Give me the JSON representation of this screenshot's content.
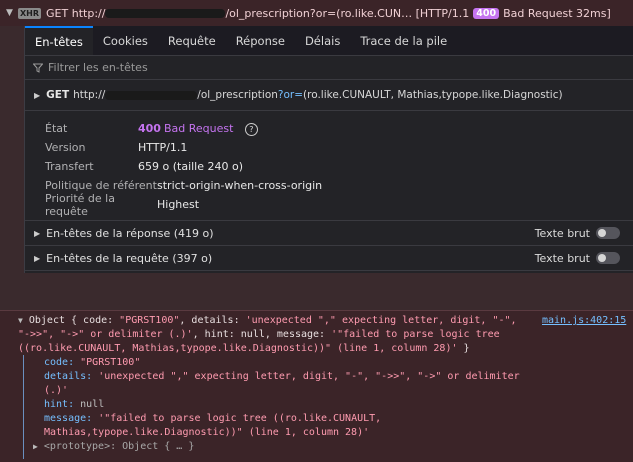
{
  "request": {
    "badge": "XHR",
    "method": "GET",
    "url_prefix": "http://",
    "url_suffix": "/ol_prescription?or=(ro.like.CUN…",
    "protocol": "[HTTP/1.1",
    "status_code": "400",
    "status_text": "Bad Request 32ms]"
  },
  "tabs": [
    "En-têtes",
    "Cookies",
    "Requête",
    "Réponse",
    "Délais",
    "Trace de la pile"
  ],
  "filter_placeholder": "Filtrer les en-têtes",
  "url_row": {
    "method": "GET",
    "url_prefix": "http://",
    "path": "/ol_prescription",
    "query": "?or=",
    "query_value": "(ro.like.CUNAULT, Mathias,typope.like.Diagnostic)"
  },
  "props": {
    "etat_label": "État",
    "etat_code": "400",
    "etat_text": "Bad Request",
    "version_label": "Version",
    "version_value": "HTTP/1.1",
    "transfert_label": "Transfert",
    "transfert_value": "659 o (taille 240 o)",
    "politique_label": "Politique de référent",
    "politique_value": "strict-origin-when-cross-origin",
    "priorite_label": "Priorité de la requête",
    "priorite_value": "Highest"
  },
  "sections": {
    "response_headers": "En-têtes de la réponse (419 o)",
    "request_headers": "En-têtes de la requête (397 o)",
    "raw_label": "Texte brut"
  },
  "console": {
    "source": "main.js:402:15",
    "line1a": "Object { code: ",
    "line1b": "\"PGRST100\"",
    "line1c": ", details: ",
    "line1d": "'unexpected \",\" expecting letter, digit, \"-\",",
    "line2": "\"->>\", \"->\" or delimiter (.)'",
    "line2b": ", hint: null, message: ",
    "line2c": "'\"failed to parse logic tree",
    "line3": "((ro.like.CUNAULT, Mathias,typope.like.Diagnostic))\" (line 1, column 28)'",
    "line3b": " }",
    "code_key": "code:",
    "code_val": "\"PGRST100\"",
    "details_key": "details:",
    "details_val1": "'unexpected \",\" expecting letter, digit, \"-\", \"->>\", \"->\" or delimiter",
    "details_val2": "(.)'",
    "hint_key": "hint:",
    "hint_val": "null",
    "message_key": "message:",
    "message_val1": "'\"failed to parse logic tree ((ro.like.CUNAULT,",
    "message_val2": "Mathias,typope.like.Diagnostic))\" (line 1, column 28)'",
    "proto": "<prototype>: Object { … }"
  }
}
